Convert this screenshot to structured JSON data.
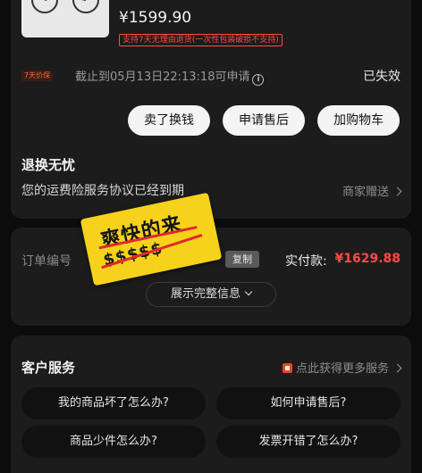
{
  "product": {
    "price": "¥1599.90",
    "promo_tag": "支持7天无理由退货(一次性包装破损不支持)",
    "guarantee_tag": "7天价保",
    "deadline": "截止到05月13日22:13:18可申请",
    "status": "已失效",
    "buttons": {
      "sell": "卖了换钱",
      "after_sale": "申请售后",
      "add_cart": "加购物车"
    },
    "return_section": {
      "title": "退换无忧",
      "desc": "您的运费险服务协议已经到期",
      "right": "商家赠送"
    }
  },
  "order": {
    "order_label": "订单编号",
    "copy": "复制",
    "paid_label": "实付款:",
    "paid_value": "¥1629.88",
    "expand": "展示完整信息"
  },
  "sticker": {
    "main": "爽快的来",
    "sub": "$$$$$"
  },
  "service": {
    "title": "客户服务",
    "more": "点此获得更多服务",
    "faq": [
      "我的商品坏了怎么办?",
      "如何申请售后?",
      "商品少件怎么办?",
      "发票开错了怎么办?"
    ]
  },
  "colors": {
    "accent_red": "#ff4848",
    "sticker_yellow": "#f6d21c"
  }
}
